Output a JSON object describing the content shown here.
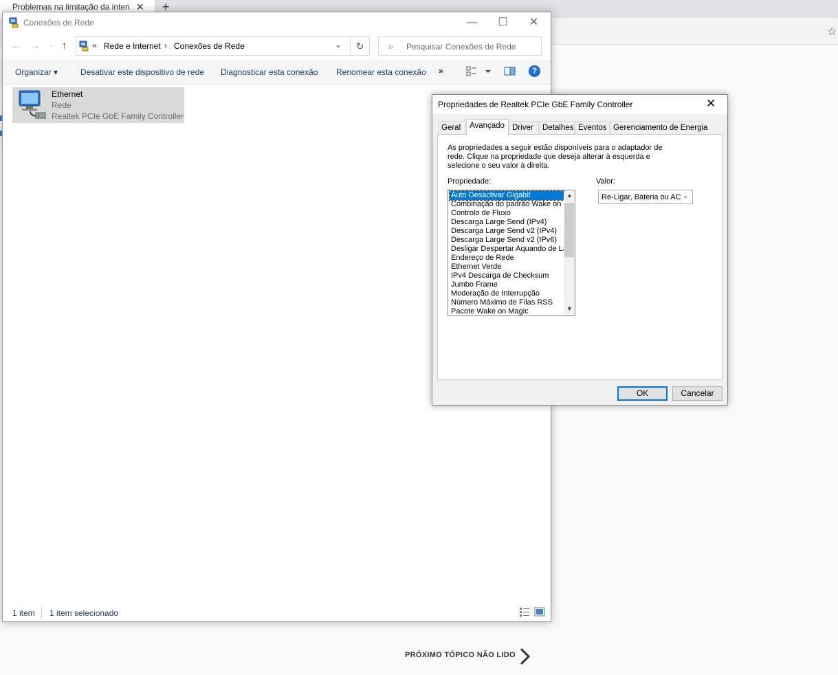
{
  "browser": {
    "tab_title": "Problemas na limitação da intern",
    "next_topic": "PRÓXIMO TÓPICO NÃO LIDO"
  },
  "explorer": {
    "title": "Conexões de Rede",
    "breadcrumb": [
      "Rede e Internet",
      "Conexões de Rede"
    ],
    "breadcrumb_overflow": "«",
    "search_placeholder": "Pesquisar Conexões de Rede",
    "commands": {
      "organize": "Organizar",
      "disable": "Desativar este dispositivo de rede",
      "diagnose": "Diagnosticar esta conexão",
      "rename": "Renomear esta conexão",
      "more": "»"
    },
    "item": {
      "name": "Ethernet",
      "type": "Rede",
      "device": "Realtek PCIe GbE Family Controller"
    },
    "status": {
      "count": "1 item",
      "selected": "1 item selecionado"
    }
  },
  "dialog": {
    "title": "Propriedades de Realtek PCIe GbE Family Controller",
    "tabs": [
      "Geral",
      "Avançado",
      "Driver",
      "Detalhes",
      "Eventos",
      "Gerenciamento de Energia"
    ],
    "active_tab": "Avançado",
    "description": "As propriedades a seguir estão disponíveis para o adaptador de rede. Clique na propriedade que deseja alterar à esquerda e selecione o seu valor à direita.",
    "property_label": "Propriedade:",
    "value_label": "Valor:",
    "properties": [
      "Auto Desactivar Gigabit",
      "Combinação do padrão Wake on",
      "Controlo de Fluxo",
      "Descarga Large Send (IPv4)",
      "Descarga Large Send v2 (IPv4)",
      "Descarga Large Send v2 (IPv6)",
      "Desligar Despertar Aquando de La",
      "Endereço de Rede",
      "Ethernet Verde",
      "IPv4 Descarga de Checksum",
      "Jumbo Frame",
      "Moderação de Interrupção",
      "Número Máximo de Filas RSS",
      "Pacote Wake on Magic"
    ],
    "selected_property": "Auto Desactivar Gigabit",
    "value": "Re-Ligar, Bateria ou AC",
    "ok": "OK",
    "cancel": "Cancelar"
  },
  "colors": {
    "accent": "#0078d7",
    "selection_bg": "#d9d9d9",
    "command_text": "#1e395b",
    "help_icon": "#1c6fce"
  }
}
